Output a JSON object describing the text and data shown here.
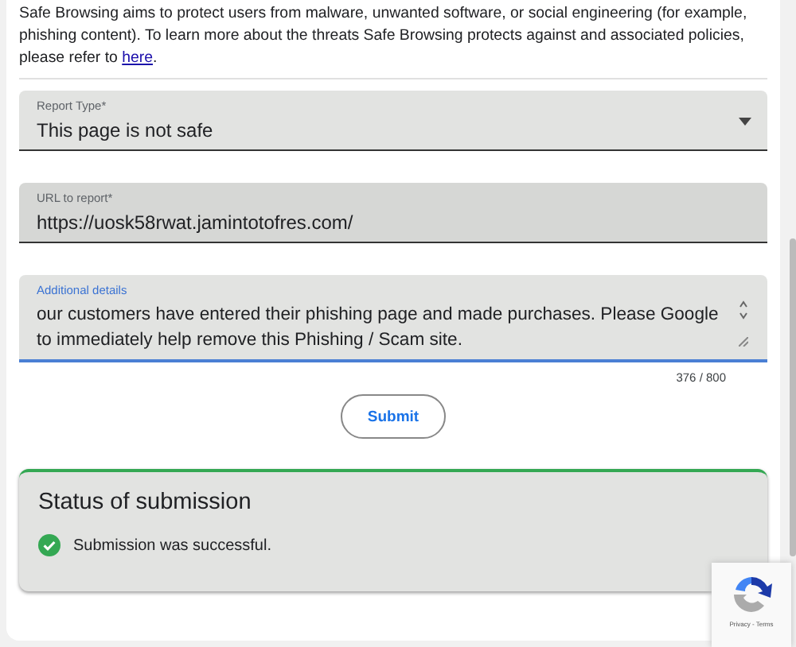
{
  "intro": {
    "text": "Safe Browsing aims to protect users from malware, unwanted software, or social engineering (for example, phishing content). To learn more about the threats Safe Browsing protects against and associated policies, please refer to ",
    "link": "here",
    "after": "."
  },
  "fields": [
    {
      "kind": "select",
      "label": "Report Type*",
      "value": "This page is not safe",
      "focused": false,
      "disabled": false
    },
    {
      "kind": "text",
      "label": "URL to report*",
      "value": "https://uosk58rwat.jamintotofres.com/",
      "focused": false,
      "disabled": true
    },
    {
      "kind": "textarea",
      "label": "Additional details",
      "value": "our customers have entered their phishing page and made purchases. Please Google to immediately help remove this Phishing / Scam site.",
      "focused": true,
      "disabled": false,
      "counter": "376 / 800"
    }
  ],
  "submit": "Submit",
  "status": {
    "title": "Status of submission",
    "message": "Submission was successful.",
    "success": true
  },
  "recaptcha": {
    "links": "Privacy - Terms"
  }
}
